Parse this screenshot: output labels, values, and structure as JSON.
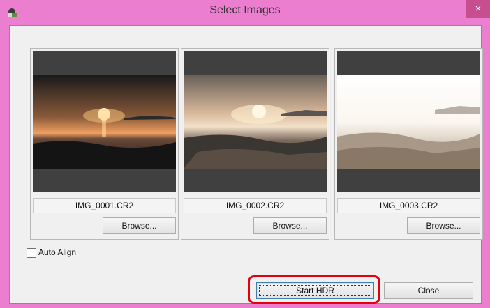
{
  "window": {
    "title": "Select Images",
    "close_glyph": "×",
    "app_icon": "app-icon",
    "titlebar_color": "#ec7ecf"
  },
  "images": [
    {
      "filename": "IMG_0001.CR2",
      "browse_label": "Browse..."
    },
    {
      "filename": "IMG_0002.CR2",
      "browse_label": "Browse..."
    },
    {
      "filename": "IMG_0003.CR2",
      "browse_label": "Browse..."
    }
  ],
  "options": {
    "auto_align_label": "Auto Align",
    "auto_align_checked": false
  },
  "buttons": {
    "start_hdr": "Start HDR",
    "close": "Close"
  },
  "annotation": {
    "highlight_color": "#e3000f"
  }
}
